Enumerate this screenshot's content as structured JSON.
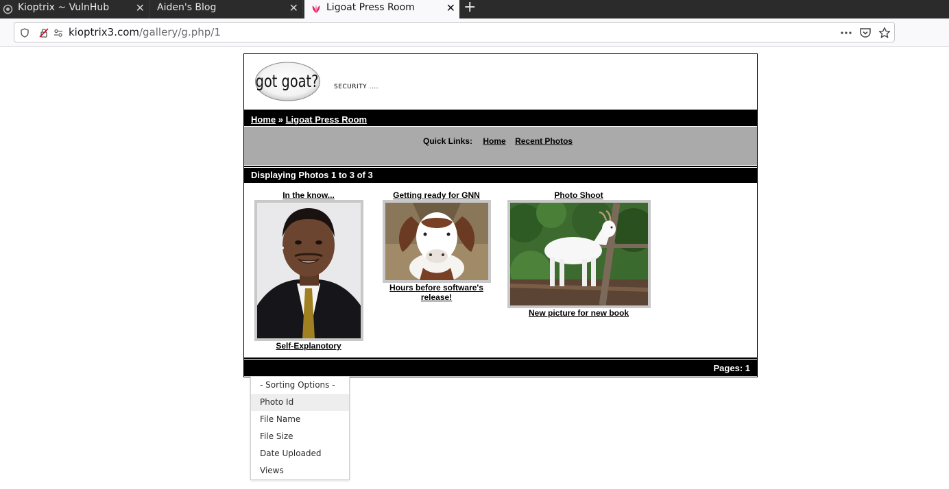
{
  "browser": {
    "tabs": [
      {
        "title": "Kioptrix ~ VulnHub",
        "active": false
      },
      {
        "title": "Aiden's Blog",
        "active": false
      },
      {
        "title": "Ligoat Press Room",
        "active": true
      }
    ],
    "url": {
      "host": "kioptrix3.com",
      "path": "/gallery/g.php/1"
    }
  },
  "page": {
    "logo_text": "got goat?",
    "tagline": "SECURITY ....",
    "breadcrumb": {
      "home": "Home",
      "separator": "»",
      "current": "Ligoat Press Room"
    },
    "quick_links": {
      "label": "Quick Links:",
      "home": "Home",
      "recent": "Recent Photos"
    },
    "display_text": "Displaying Photos 1 to 3 of 3",
    "pages_text": "Pages: 1",
    "photos": [
      {
        "title": "In the know...",
        "caption": "Self-Explanotory"
      },
      {
        "title": "Getting ready for GNN",
        "caption_line1": "Hours before software's",
        "caption_line2": "release!"
      },
      {
        "title": "Photo Shoot",
        "caption": "New picture for new book"
      }
    ]
  },
  "sort_menu": {
    "items": [
      "- Sorting Options -",
      "Photo Id",
      "File Name",
      "File Size",
      "Date Uploaded",
      "Views"
    ],
    "highlighted": "Photo Id"
  }
}
